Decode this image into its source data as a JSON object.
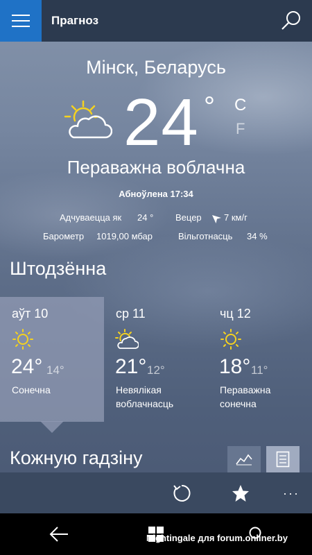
{
  "header": {
    "title": "Прагноз"
  },
  "current": {
    "city": "Мінск, Беларусь",
    "temperature": "24",
    "degree_symbol": "°",
    "unit_c": "C",
    "unit_f": "F",
    "condition": "Пераважна воблачна",
    "updated": "Абноўлена 17:34",
    "details": {
      "feels_like_label": "Адчуваецца як",
      "feels_like_value": "24 °",
      "wind_label": "Вецер",
      "wind_value": "7 км/г",
      "barometer_label": "Барометр",
      "barometer_value": "1019,00 мбар",
      "humidity_label": "Вільготнасць",
      "humidity_value": "34 %"
    }
  },
  "daily": {
    "title": "Штодзённа",
    "days": [
      {
        "name": "аўт 10",
        "high": "24°",
        "low": "14°",
        "condition": [
          "Сонечна",
          ""
        ],
        "icon": "sun-icon",
        "selected": true
      },
      {
        "name": "ср 11",
        "high": "21°",
        "low": "12°",
        "condition": [
          "Невялікая",
          "воблачнасць"
        ],
        "icon": "partly-cloudy-icon",
        "selected": false
      },
      {
        "name": "чц 12",
        "high": "18°",
        "low": "11°",
        "condition": [
          "Пераважна",
          "сонечна"
        ],
        "icon": "sun-icon",
        "selected": false
      }
    ]
  },
  "hourly": {
    "title": "Кожную гадзіну"
  },
  "appbar": {
    "more": "···"
  },
  "watermark": "Nightingale для forum.onliner.by",
  "colors": {
    "accent": "#1f72c6",
    "sun": "#f5d21f",
    "header": "#2c3a4f",
    "appbar": "#3a4960"
  }
}
